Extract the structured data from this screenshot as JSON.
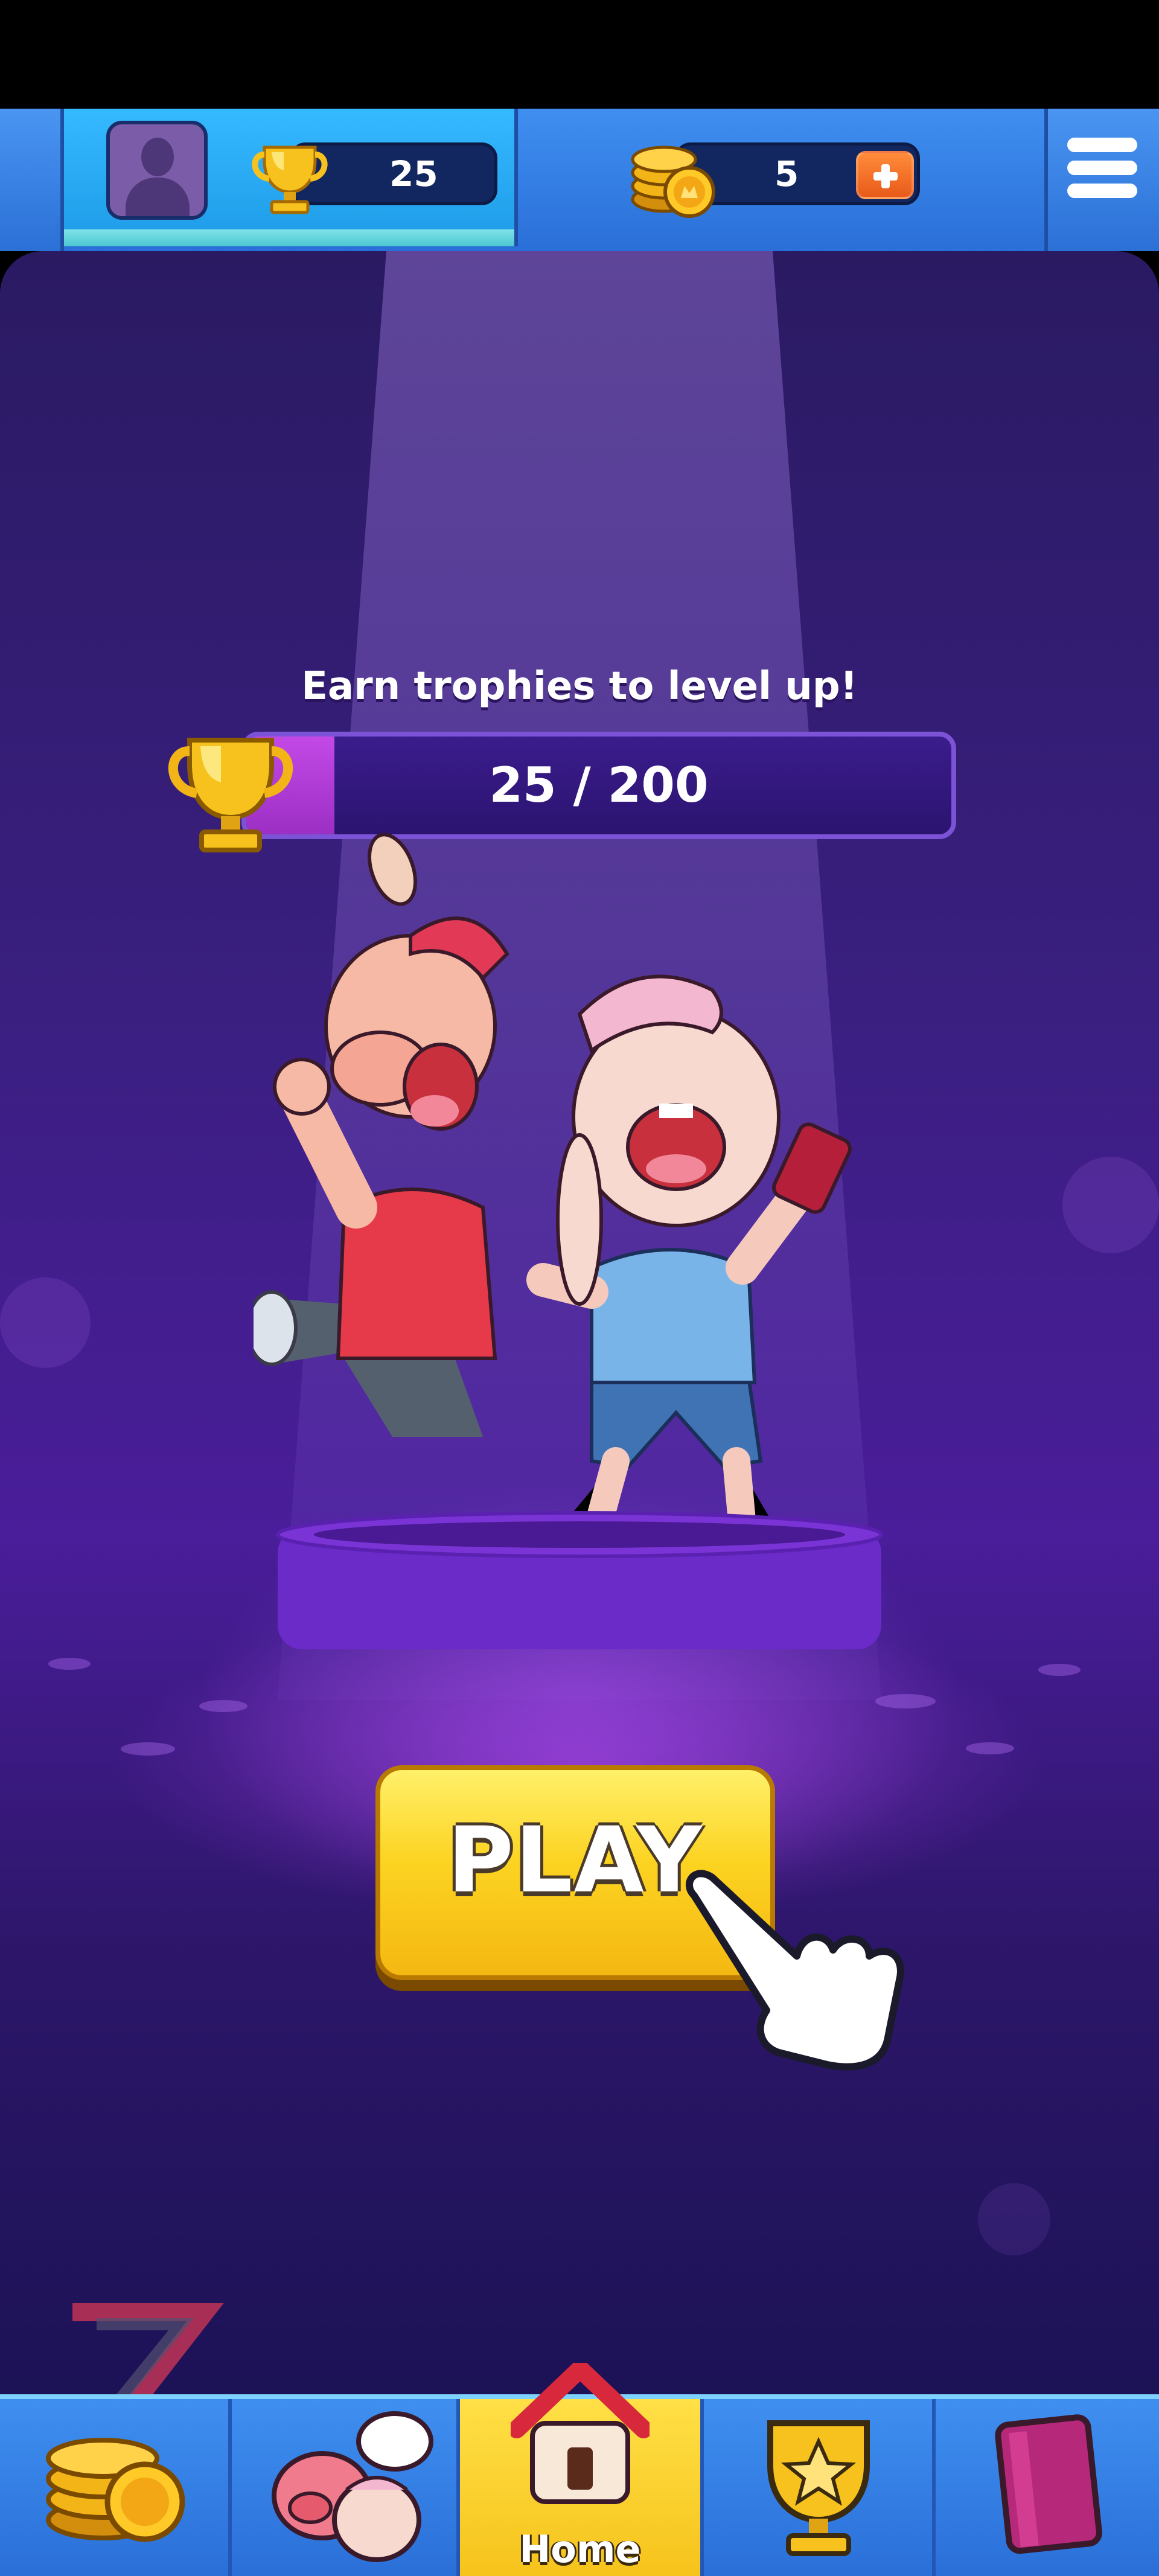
{
  "hud": {
    "trophies": "25",
    "coins": "5",
    "icons": {
      "avatar": "player-avatar",
      "trophy": "trophy-icon",
      "coins": "coins-icon",
      "add": "plus-icon",
      "menu": "hamburger-menu-icon"
    }
  },
  "main": {
    "earn_text": "Earn trophies to level up!",
    "progress_text": "25 / 200",
    "progress_fraction": 0.125,
    "play_label": "PLAY"
  },
  "bottom_nav": {
    "items": [
      {
        "name": "shop",
        "icon": "coins-icon",
        "label": ""
      },
      {
        "name": "friends",
        "icon": "characters-chat-icon",
        "label": ""
      },
      {
        "name": "home",
        "icon": "house-icon",
        "label": "Home",
        "active": true
      },
      {
        "name": "achievements",
        "icon": "star-trophy-icon",
        "label": ""
      },
      {
        "name": "collection",
        "icon": "book-icon",
        "label": ""
      }
    ]
  },
  "colors": {
    "hud_blue": "#2a6fd8",
    "stage_purple": "#3a1f80",
    "play_yellow": "#fcd321",
    "home_tab_yellow": "#f6c31b",
    "progress_fill": "#c349e6"
  }
}
